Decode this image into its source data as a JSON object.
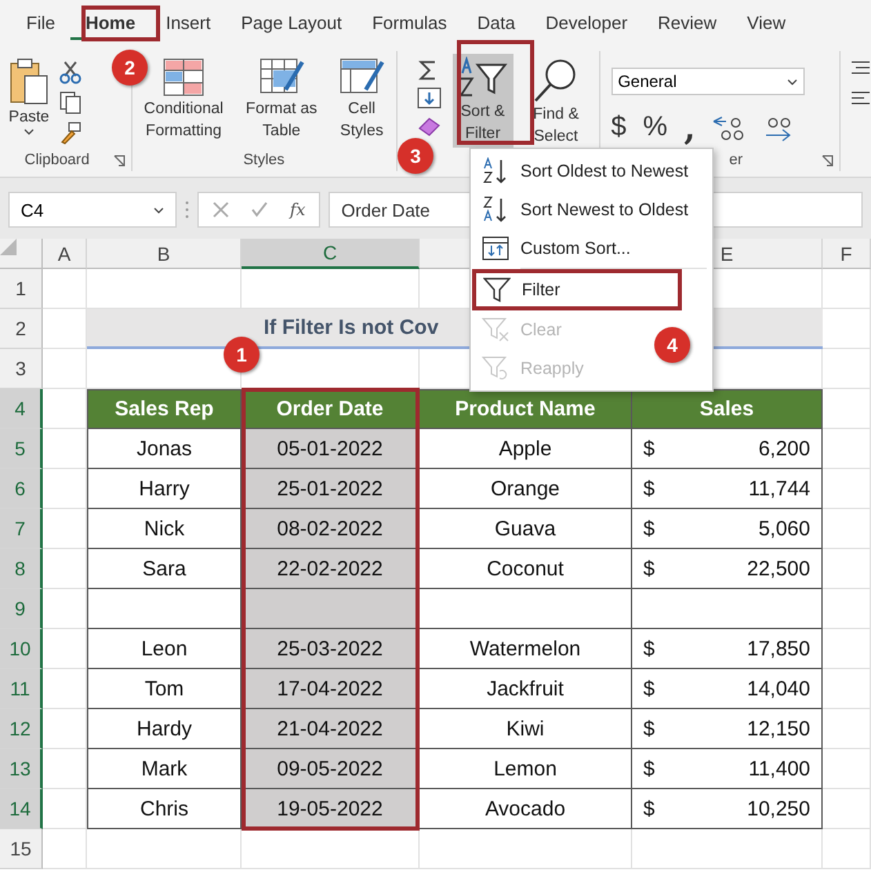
{
  "ribbon_tabs": [
    {
      "label": "File",
      "selected": false
    },
    {
      "label": "Home",
      "selected": true
    },
    {
      "label": "Insert",
      "selected": false
    },
    {
      "label": "Page Layout",
      "selected": false
    },
    {
      "label": "Formulas",
      "selected": false
    },
    {
      "label": "Data",
      "selected": false
    },
    {
      "label": "Developer",
      "selected": false
    },
    {
      "label": "Review",
      "selected": false
    },
    {
      "label": "View",
      "selected": false
    }
  ],
  "ribbon": {
    "clipboard": {
      "paste": "Paste",
      "label": "Clipboard"
    },
    "styles": {
      "buttons": [
        "Conditional Formatting",
        "Format as Table",
        "Cell Styles"
      ],
      "label": "Styles"
    },
    "editing": {
      "sort_filter": "Sort & Filter",
      "find_select": "Find & Select",
      "sort_filter_selected": true
    },
    "number": {
      "format": "General",
      "currency": "$",
      "percent": "%",
      "comma": ",",
      "label_fragment": "er"
    }
  },
  "formula_bar": {
    "name_box": "C4",
    "function_label": "fx",
    "value": "Order Date"
  },
  "sort_filter_menu": [
    {
      "label": "Sort Oldest to Newest",
      "kind": "sort-asc",
      "disabled": false,
      "highlighted": false
    },
    {
      "label": "Sort Newest to Oldest",
      "kind": "sort-desc",
      "disabled": false,
      "highlighted": false
    },
    {
      "label": "Custom Sort...",
      "kind": "custom",
      "disabled": false,
      "highlighted": false
    },
    {
      "label": "Filter",
      "kind": "filter",
      "disabled": false,
      "highlighted": true
    },
    {
      "label": "Clear",
      "kind": "clear",
      "disabled": true,
      "highlighted": false
    },
    {
      "label": "Reapply",
      "kind": "reapply",
      "disabled": true,
      "highlighted": false
    }
  ],
  "columns": [
    {
      "label": "A",
      "selected": false
    },
    {
      "label": "B",
      "selected": false
    },
    {
      "label": "C",
      "selected": true
    },
    {
      "selected": false
    },
    {
      "label": "E",
      "selected": false
    },
    {
      "label": "F",
      "selected": false
    }
  ],
  "rows": [
    {
      "number": "1",
      "selected": false,
      "kind": "blank"
    },
    {
      "number": "2",
      "selected": false,
      "kind": "title",
      "title": "If Filter Is not Cov"
    },
    {
      "number": "3",
      "selected": false,
      "kind": "blank"
    },
    {
      "number": "4",
      "selected": true,
      "kind": "header",
      "cells": [
        "Sales Rep",
        "Order Date",
        "Product Name",
        "Sales"
      ]
    },
    {
      "number": "5",
      "selected": true,
      "kind": "data",
      "sales_rep": "Jonas",
      "order_date": "05-01-2022",
      "product": "Apple",
      "currency": "$",
      "amount": "6,200"
    },
    {
      "number": "6",
      "selected": true,
      "kind": "data",
      "sales_rep": "Harry",
      "order_date": "25-01-2022",
      "product": "Orange",
      "currency": "$",
      "amount": "11,744"
    },
    {
      "number": "7",
      "selected": true,
      "kind": "data",
      "sales_rep": "Nick",
      "order_date": "08-02-2022",
      "product": "Guava",
      "currency": "$",
      "amount": "5,060"
    },
    {
      "number": "8",
      "selected": true,
      "kind": "data",
      "sales_rep": "Sara",
      "order_date": "22-02-2022",
      "product": "Coconut",
      "currency": "$",
      "amount": "22,500"
    },
    {
      "number": "9",
      "selected": true,
      "kind": "empty"
    },
    {
      "number": "10",
      "selected": true,
      "kind": "data",
      "sales_rep": "Leon",
      "order_date": "25-03-2022",
      "product": "Watermelon",
      "currency": "$",
      "amount": "17,850"
    },
    {
      "number": "11",
      "selected": true,
      "kind": "data",
      "sales_rep": "Tom",
      "order_date": "17-04-2022",
      "product": "Jackfruit",
      "currency": "$",
      "amount": "14,040"
    },
    {
      "number": "12",
      "selected": true,
      "kind": "data",
      "sales_rep": "Hardy",
      "order_date": "21-04-2022",
      "product": "Kiwi",
      "currency": "$",
      "amount": "12,150"
    },
    {
      "number": "13",
      "selected": true,
      "kind": "data",
      "sales_rep": "Mark",
      "order_date": "09-05-2022",
      "product": "Lemon",
      "currency": "$",
      "amount": "11,400"
    },
    {
      "number": "14",
      "selected": true,
      "kind": "data",
      "sales_rep": "Chris",
      "order_date": "19-05-2022",
      "product": "Avocado",
      "currency": "$",
      "amount": "10,250"
    },
    {
      "number": "15",
      "selected": false,
      "kind": "blank"
    }
  ],
  "step_badges": [
    {
      "label": "2"
    },
    {
      "label": "3"
    },
    {
      "label": "1"
    },
    {
      "label": "4"
    }
  ]
}
